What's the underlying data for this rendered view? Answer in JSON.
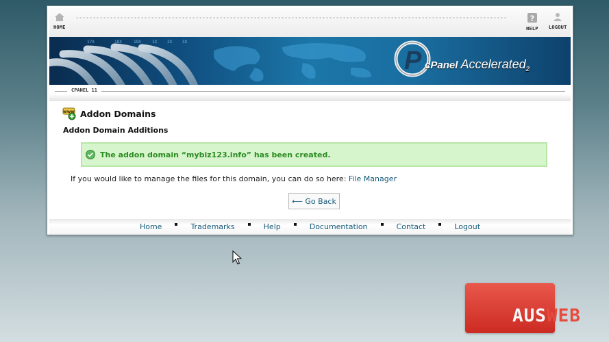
{
  "topnav": {
    "home_label": "HOME",
    "help_label": "HELP",
    "logout_label": "LOGOUT"
  },
  "banner": {
    "brand_prefix": "cPanel",
    "brand_main": "Accelerated",
    "brand_suffix": "2"
  },
  "version_label": "CPANEL 11",
  "page": {
    "title": "Addon Domains",
    "section_title": "Addon Domain Additions",
    "success_message": "The addon domain “mybiz123.info” has been created.",
    "manage_text": "If you would like to manage the files for this domain, you can do so here:",
    "manage_link": "File Manager",
    "go_back_label": "⟵ Go Back"
  },
  "footer": {
    "links": [
      "Home",
      "Trademarks",
      "Help",
      "Documentation",
      "Contact",
      "Logout"
    ]
  },
  "watermark": {
    "part1": "AUS",
    "part2": "WEB"
  },
  "colors": {
    "success_bg": "#d7f5cc",
    "success_text": "#2b8b22",
    "link": "#14597a",
    "watermark_red": "#d9352c"
  }
}
